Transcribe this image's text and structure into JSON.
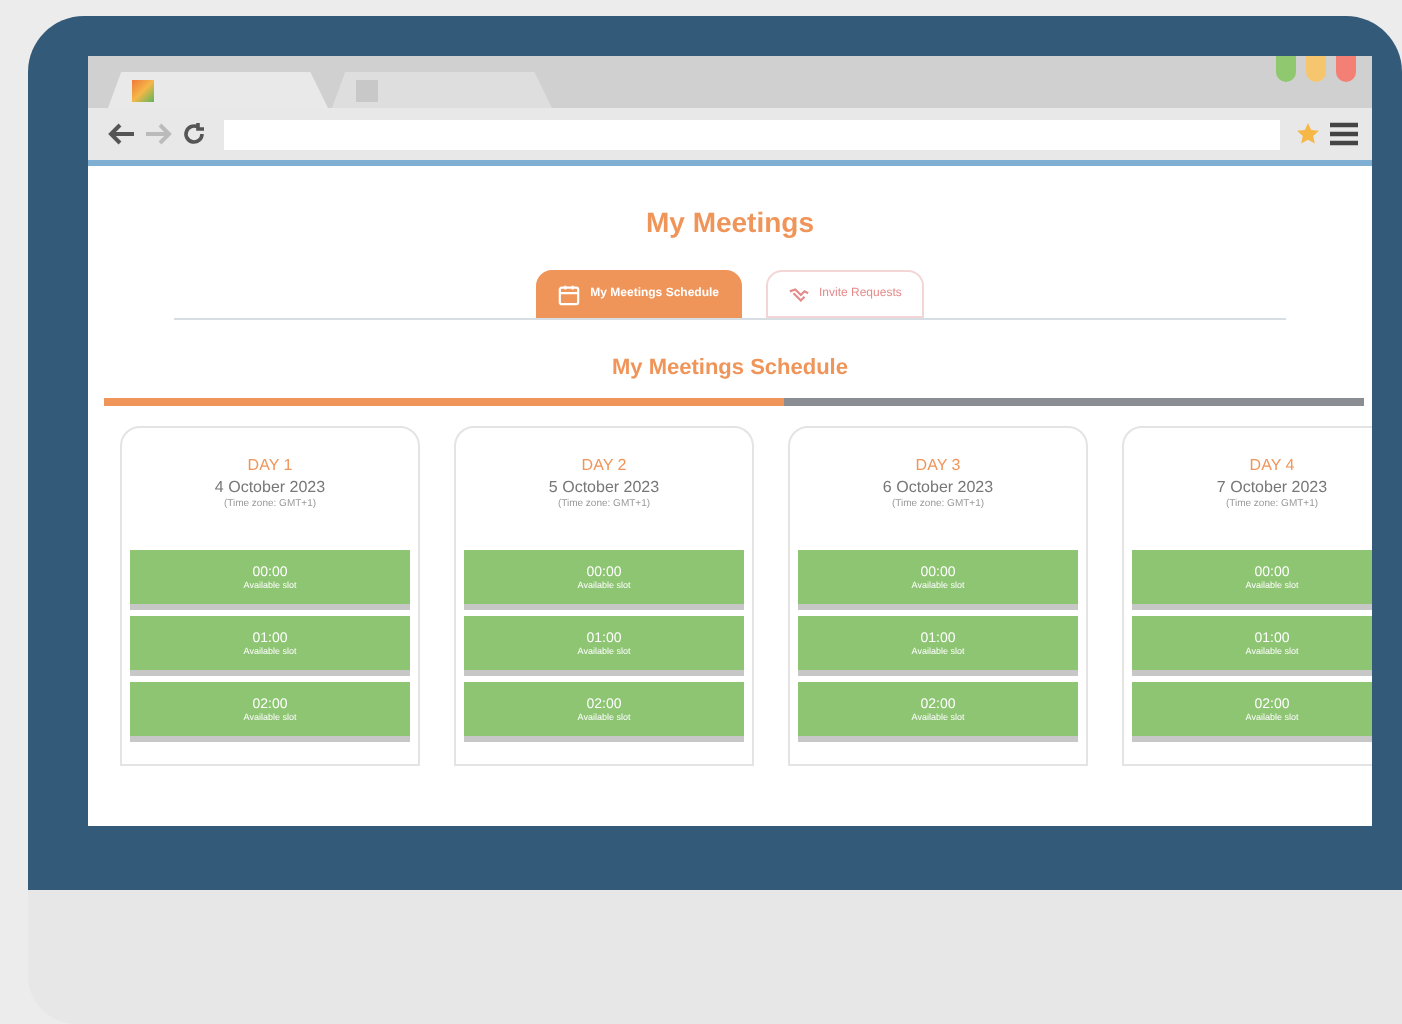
{
  "browser": {
    "tabs": [
      {
        "selected": true
      },
      {
        "selected": false
      }
    ]
  },
  "page": {
    "title": "My Meetings",
    "tabs": [
      {
        "label": "My Meetings Schedule",
        "selected": true,
        "kind": "calendar"
      },
      {
        "label": "Invite Requests",
        "selected": false,
        "kind": "handshake"
      }
    ],
    "section_title": "My Meetings Schedule",
    "progress": {
      "level": 0.54
    },
    "days": [
      {
        "label": "DAY 1",
        "date": "4 October 2023",
        "note": "(Time zone: GMT+1)",
        "slots": [
          {
            "time": "00:00",
            "status": "Available slot"
          },
          {
            "time": "01:00",
            "status": "Available slot"
          },
          {
            "time": "02:00",
            "status": "Available slot"
          }
        ]
      },
      {
        "label": "DAY 2",
        "date": "5 October 2023",
        "note": "(Time zone: GMT+1)",
        "slots": [
          {
            "time": "00:00",
            "status": "Available slot"
          },
          {
            "time": "01:00",
            "status": "Available slot"
          },
          {
            "time": "02:00",
            "status": "Available slot"
          }
        ]
      },
      {
        "label": "DAY 3",
        "date": "6 October 2023",
        "note": "(Time zone: GMT+1)",
        "slots": [
          {
            "time": "00:00",
            "status": "Available slot"
          },
          {
            "time": "01:00",
            "status": "Available slot"
          },
          {
            "time": "02:00",
            "status": "Available slot"
          }
        ]
      },
      {
        "label": "DAY 4",
        "date": "7 October 2023",
        "note": "(Time zone: GMT+1)",
        "slots": [
          {
            "time": "00:00",
            "status": "Available slot"
          },
          {
            "time": "01:00",
            "status": "Available slot"
          },
          {
            "time": "02:00",
            "status": "Available slot"
          }
        ]
      }
    ]
  }
}
